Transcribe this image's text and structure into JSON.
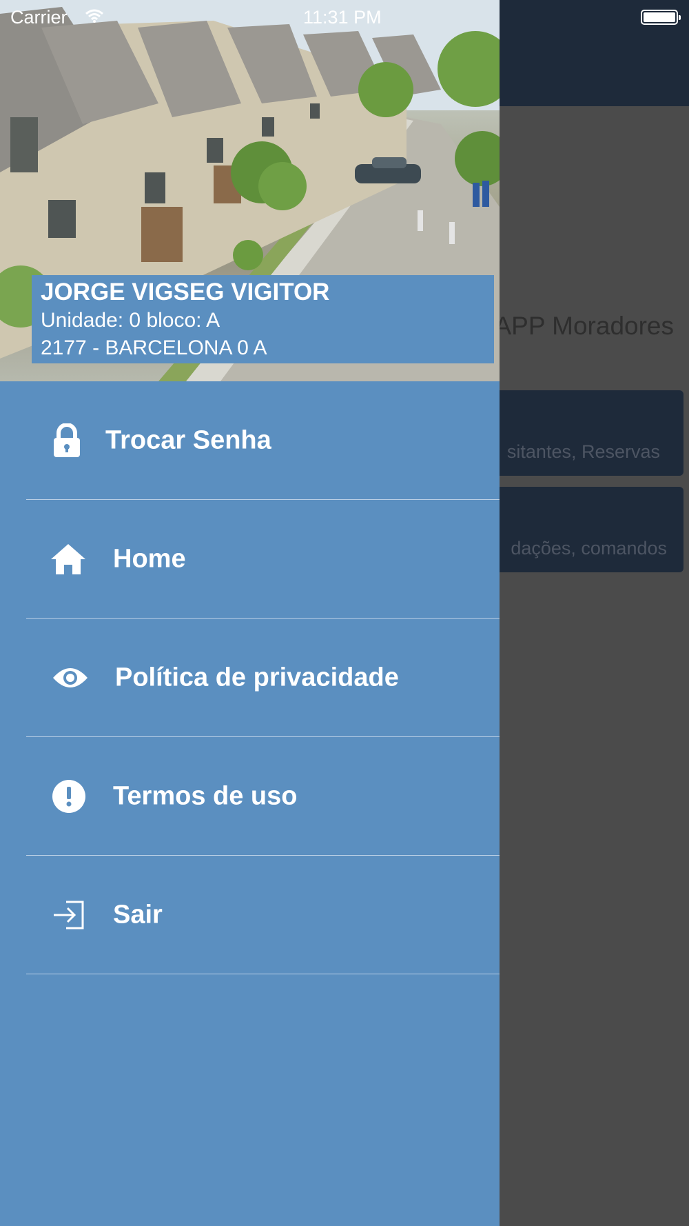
{
  "status_bar": {
    "carrier": "Carrier",
    "time": "11:31 PM"
  },
  "background_app": {
    "title": "APP Moradores",
    "cards": [
      {
        "subtitle": "sitantes, Reservas"
      },
      {
        "subtitle": "dações, comandos"
      }
    ]
  },
  "drawer": {
    "user": {
      "name": "JORGE VIGSEG VIGITOR",
      "unit": "Unidade: 0 bloco: A",
      "building": "2177 - BARCELONA 0 A"
    },
    "menu": [
      {
        "label": "Trocar Senha",
        "icon": "lock-icon"
      },
      {
        "label": "Home",
        "icon": "home-icon"
      },
      {
        "label": "Política de privacidade",
        "icon": "eye-icon"
      },
      {
        "label": "Termos de uso",
        "icon": "alert-circle-icon"
      },
      {
        "label": "Sair",
        "icon": "sign-in-icon"
      }
    ]
  },
  "colors": {
    "drawer": "#5b8fc0",
    "navbar": "#1e2a3a",
    "overlay": "#4b4b4b"
  }
}
